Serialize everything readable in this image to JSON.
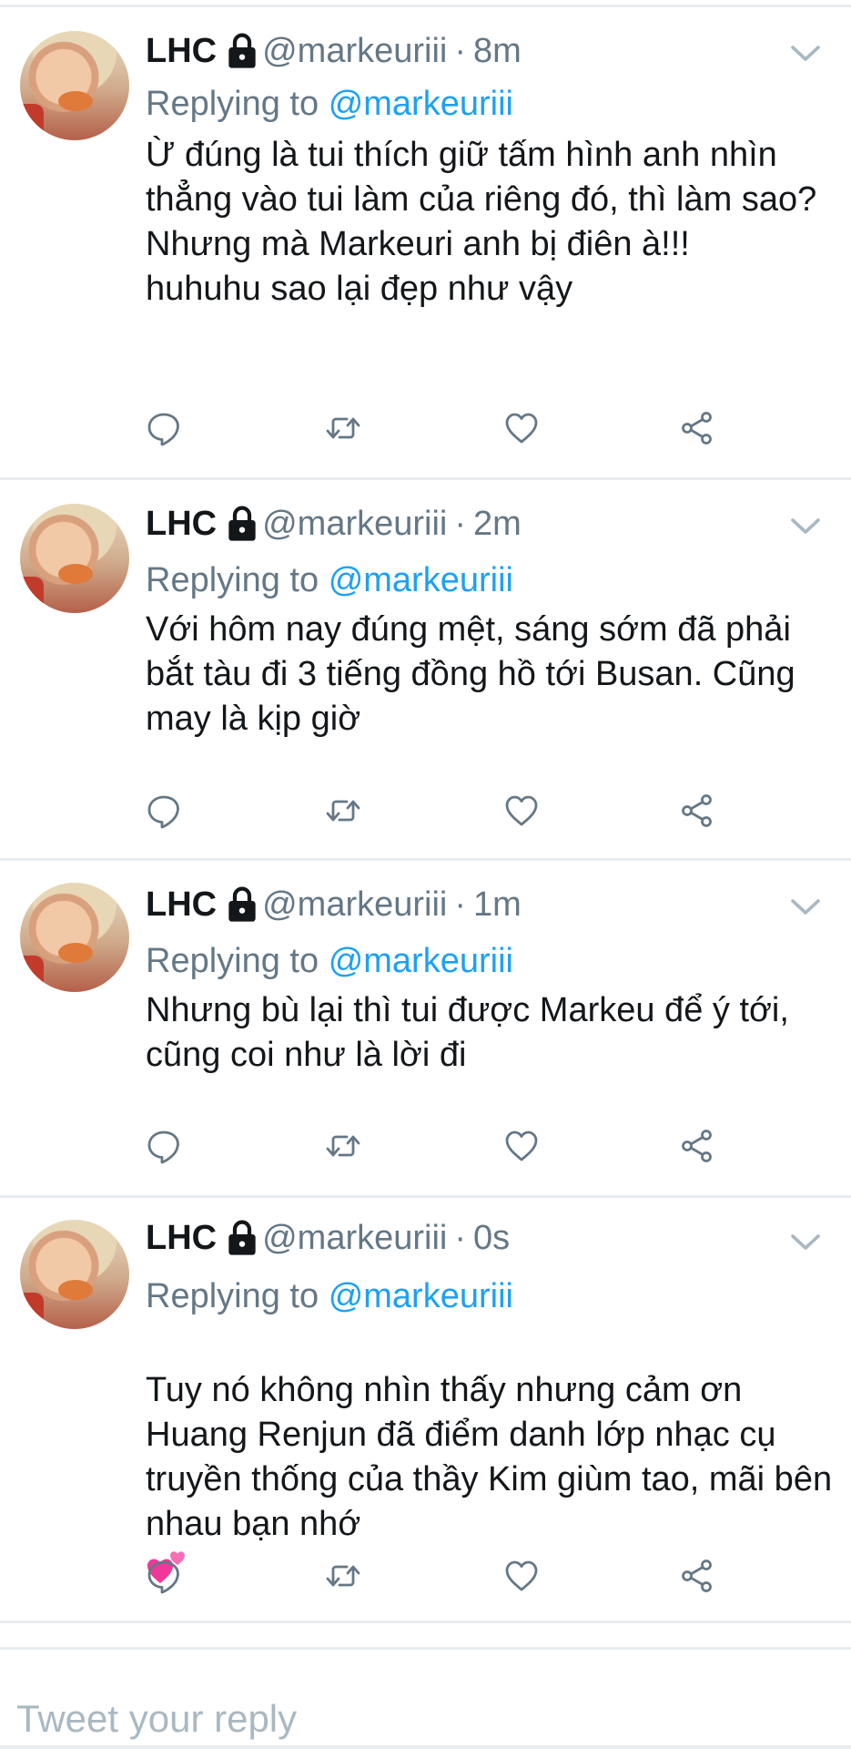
{
  "tweets": [
    {
      "name": "LHC",
      "handle": "@markeuriii",
      "dot": "·",
      "time": "8m",
      "replying_label": "Replying to",
      "replying_to": "@markeuriii",
      "text": "Ừ đúng là tui thích giữ tấm hình anh nhìn thẳng vào tui làm của riêng đó, thì làm sao?\nNhưng mà Markeuri anh bị điên à!!!\nhuhuhu sao lại đẹp như vậy"
    },
    {
      "name": "LHC",
      "handle": "@markeuriii",
      "dot": "·",
      "time": "2m",
      "replying_label": "Replying to",
      "replying_to": "@markeuriii",
      "text": "Với hôm nay đúng mệt, sáng sớm đã phải bắt tàu đi 3 tiếng đồng hồ tới Busan. Cũng may là kịp giờ"
    },
    {
      "name": "LHC",
      "handle": "@markeuriii",
      "dot": "·",
      "time": "1m",
      "replying_label": "Replying to",
      "replying_to": "@markeuriii",
      "text": "Nhưng bù lại thì tui được Markeu để ý tới, cũng coi như là lời đi"
    },
    {
      "name": "LHC",
      "handle": "@markeuriii",
      "dot": "·",
      "time": "0s",
      "replying_label": "Replying to",
      "replying_to": "@markeuriii",
      "text": "Tuy nó không nhìn thấy nhưng cảm ơn Huang Renjun đã điểm danh lớp nhạc cụ truyền thống của thầy Kim giùm tao, mãi bên nhau bạn nhớ"
    }
  ],
  "icons": {
    "verified_lock": "lock-icon",
    "menu": "chevron-down-icon",
    "reply": "reply-icon",
    "retweet": "retweet-icon",
    "like": "heart-icon",
    "share": "share-icon",
    "emoji": "two-hearts-emoji"
  },
  "colors": {
    "accent": "#1da1f2",
    "secondary_text": "#657786",
    "divider": "#e6ecf0",
    "emoji_pink": "#f0389a"
  },
  "compose": {
    "placeholder": "Tweet your reply"
  }
}
